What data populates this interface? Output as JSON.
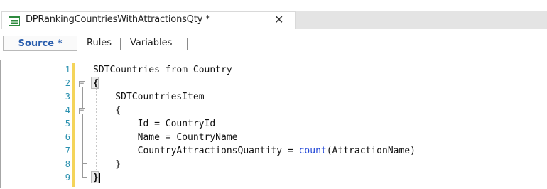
{
  "tab": {
    "title": "DPRankingCountriesWithAttractionsQty *",
    "close_glyph": "✕",
    "icon": "data-provider-icon"
  },
  "subtabs": [
    {
      "label": "Source *",
      "active": true
    },
    {
      "label": "Rules",
      "active": false
    },
    {
      "label": "Variables",
      "active": false
    }
  ],
  "editor": {
    "line_numbers": [
      "1",
      "2",
      "3",
      "4",
      "5",
      "6",
      "7",
      "8",
      "9"
    ],
    "lines": [
      {
        "parts": [
          {
            "t": "SDTCountries from Country"
          }
        ]
      },
      {
        "parts": [
          {
            "t": "{",
            "cls": "brace"
          }
        ]
      },
      {
        "parts": [
          {
            "t": "    SDTCountriesItem"
          }
        ]
      },
      {
        "parts": [
          {
            "t": "    {"
          }
        ]
      },
      {
        "parts": [
          {
            "t": "        Id = CountryId"
          }
        ]
      },
      {
        "parts": [
          {
            "t": "        Name = CountryName"
          }
        ]
      },
      {
        "parts": [
          {
            "t": "        CountryAttractionsQuantity = "
          },
          {
            "t": "count",
            "cls": "kw"
          },
          {
            "t": "(AttractionName)"
          }
        ]
      },
      {
        "parts": [
          {
            "t": "    }"
          }
        ]
      },
      {
        "parts": [
          {
            "t": "}",
            "cls": "brace"
          }
        ]
      }
    ]
  },
  "colors": {
    "keyword": "#1f45d6",
    "line_number": "#2b91af",
    "change_bar": "#f4d45a",
    "active_subtab_text": "#2b5fae"
  }
}
